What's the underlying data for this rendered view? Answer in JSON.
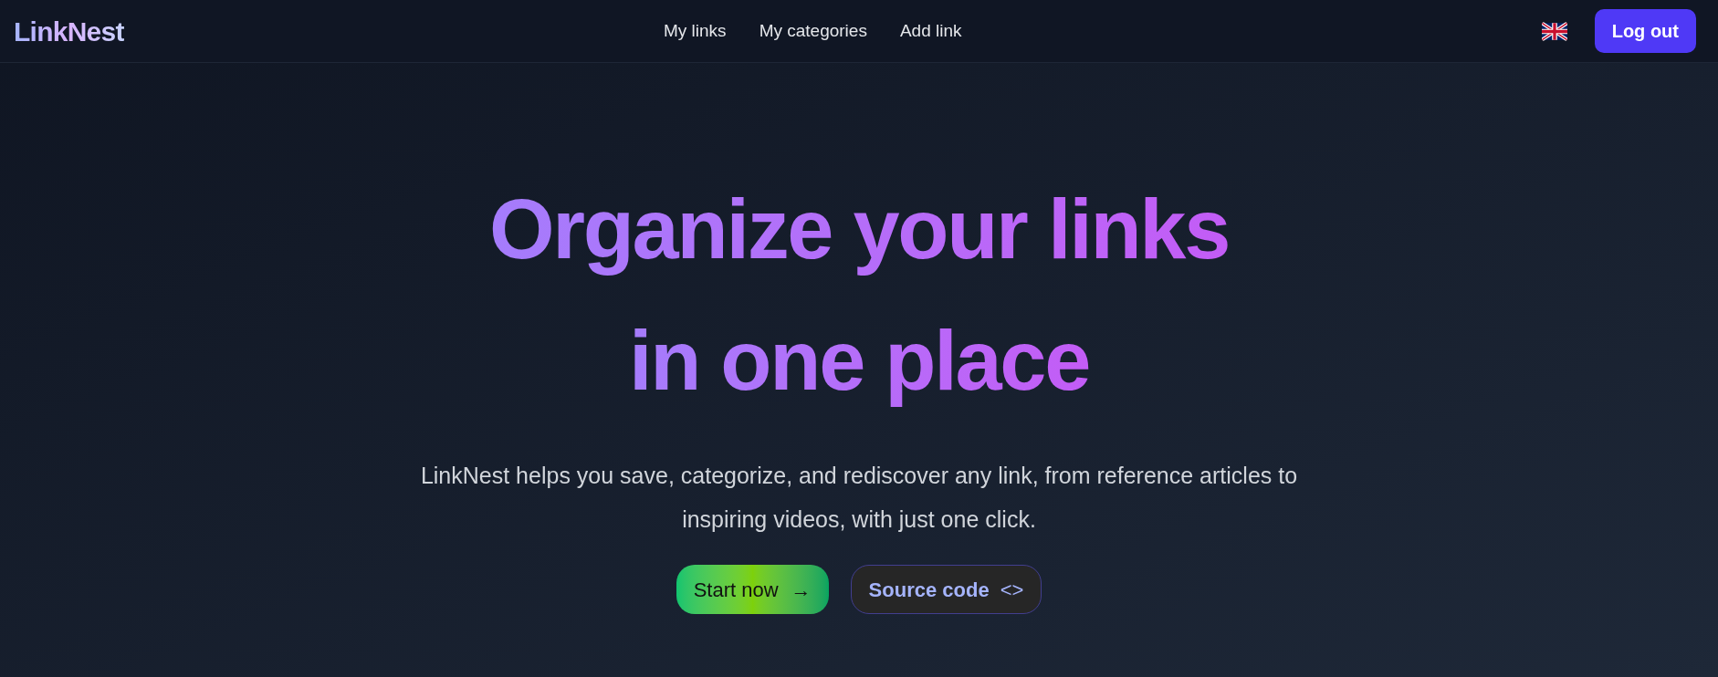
{
  "brand": "LinkNest",
  "nav": [
    {
      "label": "My links"
    },
    {
      "label": "My categories"
    },
    {
      "label": "Add link"
    }
  ],
  "logout": "Log out",
  "hero": {
    "title_lines": [
      "Organize your links",
      "in one place"
    ],
    "subtitle": "LinkNest helps you save, categorize, and rediscover any link, from reference articles to inspiring videos, with just one click.",
    "buttons": [
      {
        "kind": "primary",
        "label": "Start now",
        "icon": "→"
      },
      {
        "kind": "outline",
        "label": "Source code",
        "icon": "<>"
      }
    ]
  }
}
